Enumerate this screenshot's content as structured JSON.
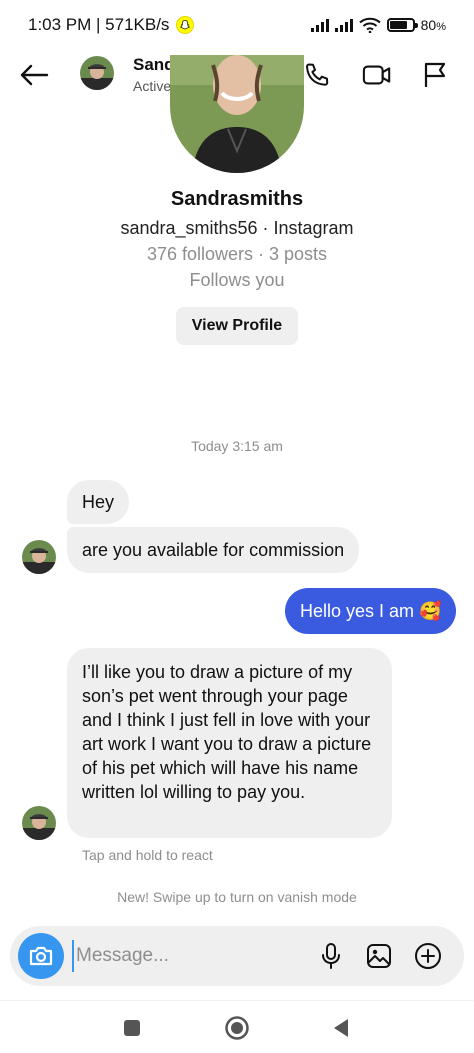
{
  "status_bar": {
    "time_speed": "1:03 PM | 571KB/s",
    "battery": "80",
    "battery_unit": "%",
    "battery_level": 0.8
  },
  "header": {
    "name": "Sandrasmiths",
    "subtitle": "Active 8m ago",
    "icons": [
      "back-arrow-icon",
      "phone-icon",
      "video-icon",
      "flag-icon"
    ]
  },
  "profile": {
    "name": "Sandrasmiths",
    "handle": "sandra_smiths56 · Instagram",
    "stats": "376 followers · 3 posts",
    "follows": "Follows you",
    "view_profile_label": "View Profile"
  },
  "timestamp": "Today 3:15 am",
  "messages": [
    {
      "from": "them",
      "text": "Hey"
    },
    {
      "from": "them",
      "text": "are you available for commission"
    },
    {
      "from": "me",
      "text": "Hello yes I am 🥰"
    },
    {
      "from": "them",
      "text": "I’ll like you to draw a picture of my son’s pet went through your page and I think I just fell in love with your art work I want you to draw a picture of his pet which will have his name written lol willing to pay you."
    }
  ],
  "hint": "Tap and hold to react",
  "vanish": "New! Swipe up to turn on vanish mode",
  "composer": {
    "placeholder": "Message...",
    "icons": [
      "camera-icon",
      "microphone-icon",
      "gallery-icon",
      "add-icon"
    ]
  },
  "colors": {
    "accent_blue": "#3797f0",
    "outgoing_bubble": "#3a5be0",
    "incoming_bubble": "#efefef"
  }
}
